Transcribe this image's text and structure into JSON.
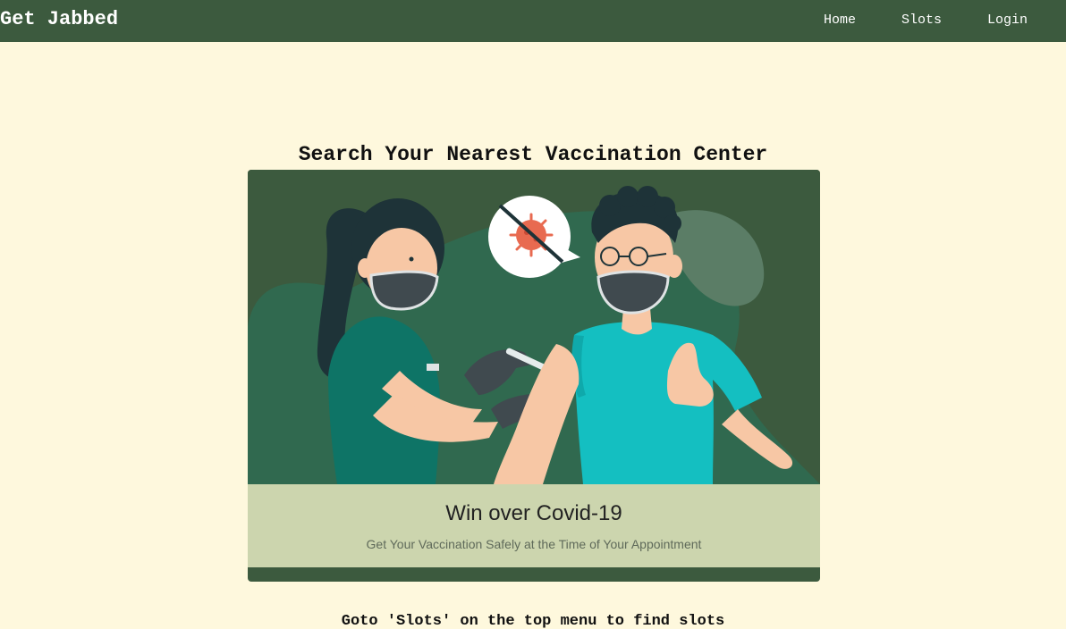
{
  "navbar": {
    "brand": "Get Jabbed",
    "links": [
      {
        "label": "Home"
      },
      {
        "label": "Slots"
      },
      {
        "label": "Login"
      }
    ]
  },
  "main": {
    "heading": "Search Your Nearest Vaccination Center",
    "card": {
      "illustration_icon": "vaccination-illustration",
      "title": "Win over Covid-19",
      "text": "Get Your Vaccination Safely at the Time of Your Appointment"
    },
    "hint": "Goto 'Slots' on the top menu to find slots"
  },
  "colors": {
    "navbar": "#3c5a3e",
    "background": "#fef8dd",
    "caption": "#ccd5ae"
  }
}
